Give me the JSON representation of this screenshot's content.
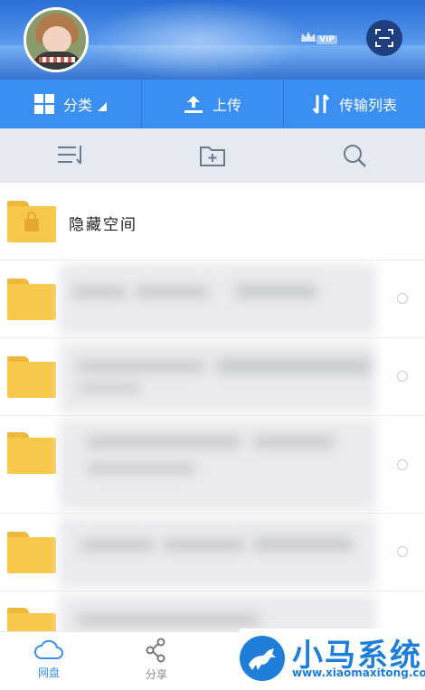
{
  "header": {
    "vip_label": "VIP"
  },
  "actions": {
    "category_label": "分类",
    "upload_label": "上传",
    "transfer_label": "传输列表"
  },
  "files": [
    {
      "name": "隐藏空间",
      "locked": true
    }
  ],
  "bottom_nav": {
    "disk_label": "网盘",
    "share_label": "分享"
  },
  "watermark": {
    "title": "小马系统",
    "url": "www.xiaomaxitong.com"
  },
  "colors": {
    "primary": "#3b8ff0",
    "folder": "#f7c84a",
    "toolbar_bg": "#e5eaf0"
  }
}
